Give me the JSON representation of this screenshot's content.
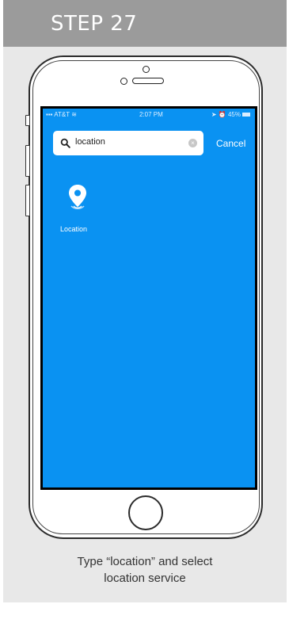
{
  "header": {
    "title": "STEP 27"
  },
  "status_bar": {
    "carrier": "AT&T",
    "time": "2:07 PM",
    "battery": "45%"
  },
  "search": {
    "query": "location",
    "cancel_label": "Cancel"
  },
  "results": [
    {
      "label": "Location",
      "icon": "location-pin-icon"
    }
  ],
  "caption": {
    "line1": "Type “location” and select",
    "line2": "location service"
  },
  "colors": {
    "header_bg": "#9b9b9b",
    "card_bg": "#e8e8e8",
    "screen_bg": "#0a92f2"
  }
}
